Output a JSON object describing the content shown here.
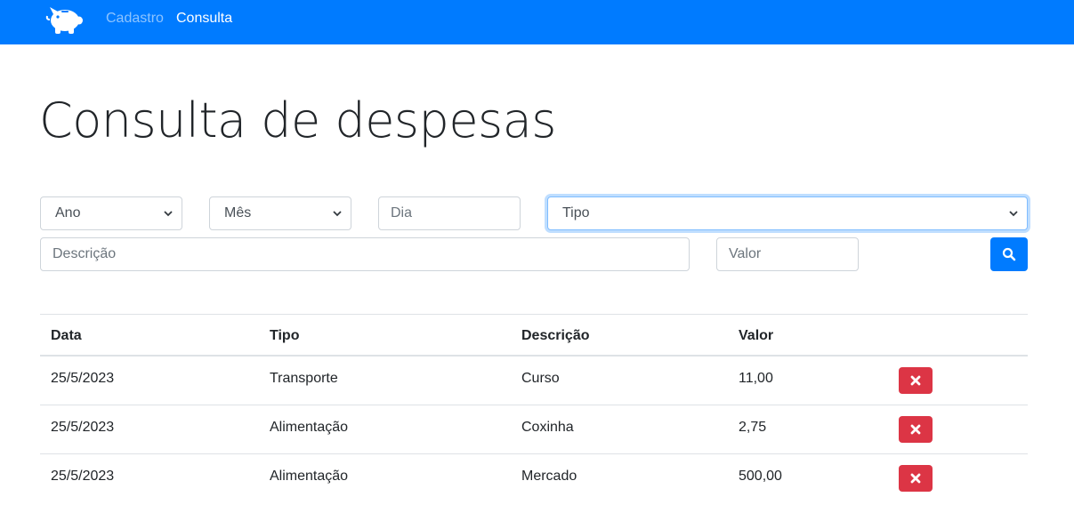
{
  "nav": {
    "brand_icon": "piggy-bank-icon",
    "links": [
      {
        "label": "Cadastro",
        "active": false
      },
      {
        "label": "Consulta",
        "active": true
      }
    ]
  },
  "title": "Consulta de despesas",
  "filters": {
    "ano": {
      "value": "Ano"
    },
    "mes": {
      "value": "Mês"
    },
    "dia": {
      "placeholder": "Dia"
    },
    "tipo": {
      "value": "Tipo"
    },
    "descricao": {
      "placeholder": "Descrição"
    },
    "valor": {
      "placeholder": "Valor"
    },
    "search_icon": "search-icon"
  },
  "table": {
    "headers": [
      "Data",
      "Tipo",
      "Descrição",
      "Valor"
    ],
    "rows": [
      {
        "data": "25/5/2023",
        "tipo": "Transporte",
        "descricao": "Curso",
        "valor": "11,00"
      },
      {
        "data": "25/5/2023",
        "tipo": "Alimentação",
        "descricao": "Coxinha",
        "valor": "2,75"
      },
      {
        "data": "25/5/2023",
        "tipo": "Alimentação",
        "descricao": "Mercado",
        "valor": "500,00"
      }
    ],
    "delete_icon": "times-icon"
  },
  "colors": {
    "primary": "#007bff",
    "danger": "#dc3545",
    "border": "#dee2e6",
    "text": "#212529"
  }
}
